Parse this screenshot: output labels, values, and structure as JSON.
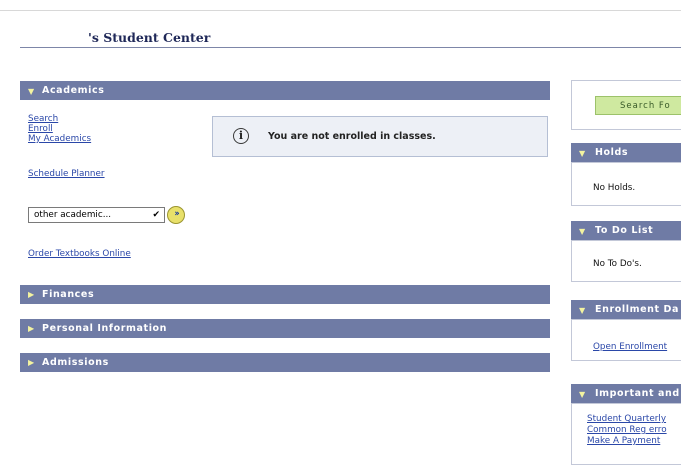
{
  "header": {
    "title": "'s Student Center"
  },
  "academics": {
    "heading": "Academics",
    "links": [
      "Search",
      "Enroll",
      "My Academics"
    ],
    "schedule_planner": "Schedule Planner",
    "message": "You are not enrolled in classes.",
    "select_value": "other academic...",
    "order_textbooks": "Order Textbooks Online"
  },
  "sections": [
    "Finances",
    "Personal Information",
    "Admissions"
  ],
  "sidebar": {
    "search_button": "Search Fo",
    "holds": {
      "title": "Holds",
      "text": "No Holds."
    },
    "todo": {
      "title": "To Do List",
      "text": "No To Do's."
    },
    "enrollment": {
      "title": "Enrollment Da",
      "link": "Open Enrollment"
    },
    "important": {
      "title": "Important and",
      "links": [
        "Student Quarterly",
        "Common Reg erro",
        "Make A Payment"
      ]
    }
  },
  "icons": {
    "expanded": "triangle-down-icon",
    "collapsed": "triangle-right-icon",
    "info": "info-circle-icon",
    "go": "double-chevron-right-icon"
  },
  "colors": {
    "band": "#6f7ba5",
    "link": "#2a47a8",
    "search_button": "#cfe9a0"
  }
}
